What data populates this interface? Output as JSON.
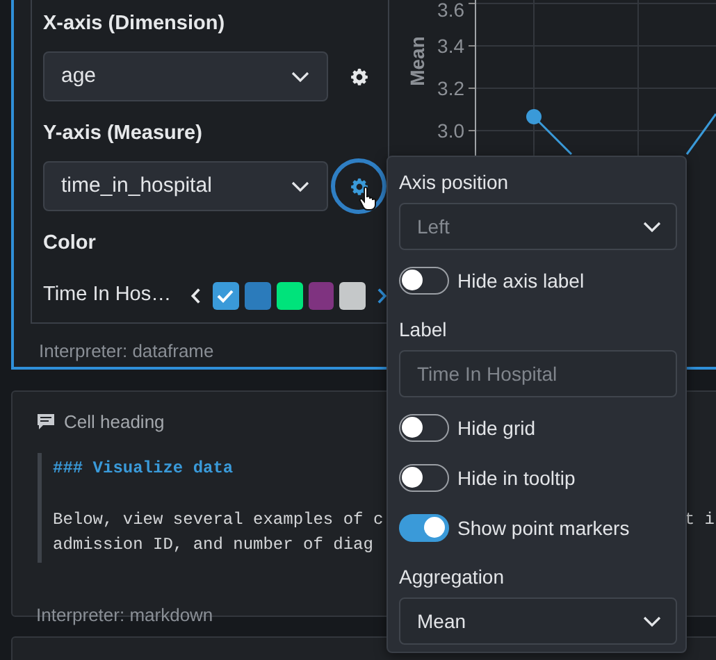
{
  "chart_cell": {
    "fields": [
      {
        "label": "X-axis (Dimension)",
        "value": "age",
        "gear_highlighted": false
      },
      {
        "label": "Y-axis (Measure)",
        "value": "time_in_hospital",
        "gear_highlighted": true
      }
    ],
    "color": {
      "label": "Color",
      "series_name": "Time In Hos…",
      "swatches": [
        {
          "color": "#3a9ad9",
          "selected": true
        },
        {
          "color": "#2b7bbb",
          "selected": false
        },
        {
          "color": "#00e37b",
          "selected": false
        },
        {
          "color": "#7f3380",
          "selected": false
        },
        {
          "color": "#c5c8c9",
          "selected": false
        }
      ]
    },
    "interpreter": "Interpreter: dataframe",
    "y_axis": {
      "title": "Mean",
      "ticks": [
        "3.6",
        "3.4",
        "3.2",
        "3.0"
      ]
    }
  },
  "popup": {
    "items": [
      {
        "kind": "select",
        "label": "Axis position",
        "value": "Left",
        "disabled": true
      },
      {
        "kind": "toggle",
        "label": "Hide axis label",
        "on": false
      },
      {
        "kind": "input",
        "label": "Label",
        "placeholder": "Time In Hospital"
      },
      {
        "kind": "toggle",
        "label": "Hide grid",
        "on": false
      },
      {
        "kind": "toggle",
        "label": "Hide in tooltip",
        "on": false
      },
      {
        "kind": "toggle",
        "label": "Show point markers",
        "on": true
      },
      {
        "kind": "select",
        "label": "Aggregation",
        "value": "Mean",
        "disabled": false
      }
    ]
  },
  "markdown_cell": {
    "title": "Cell heading",
    "lines": [
      {
        "kind": "heading",
        "text": "### Visualize data"
      },
      {
        "kind": "text",
        "text": "Below, view several examples of c",
        "tail": "t i"
      },
      {
        "kind": "text",
        "text": "admission ID, and number of diag"
      }
    ],
    "interpreter": "Interpreter: markdown"
  }
}
